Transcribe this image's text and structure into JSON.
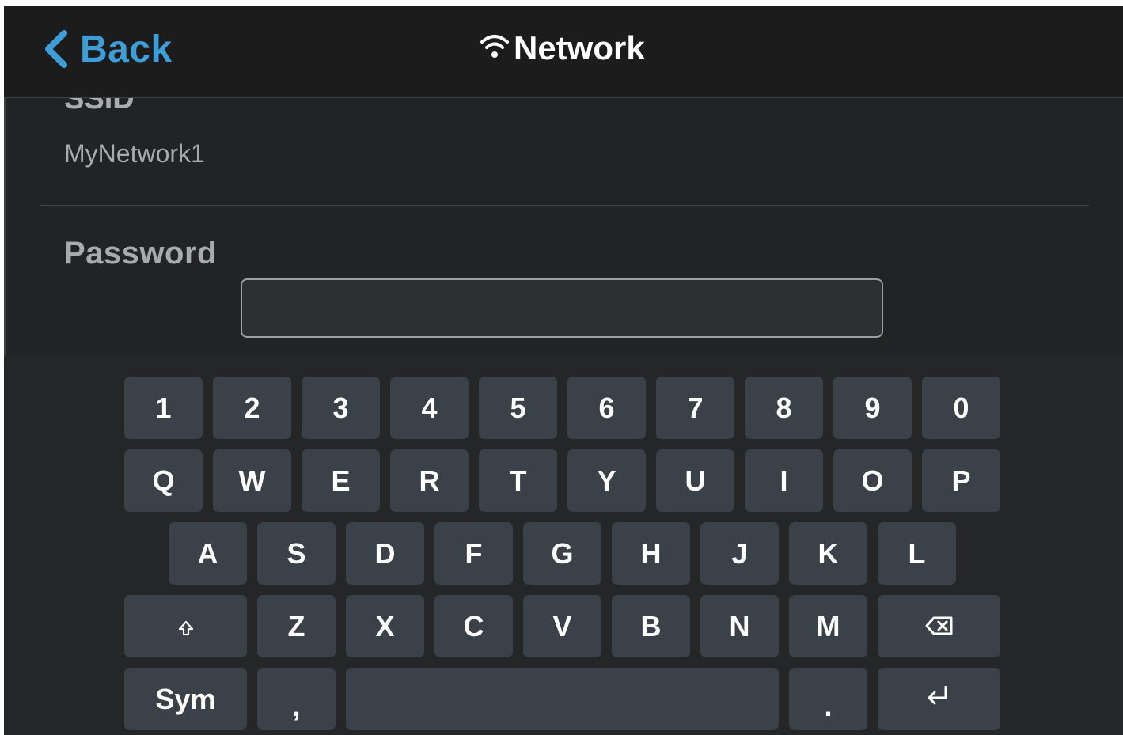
{
  "header": {
    "back_label": "Back",
    "title": "Network",
    "back_icon": "chevron-left-icon",
    "title_icon": "wifi-icon",
    "accent_color": "#3d9ed8"
  },
  "form": {
    "ssid_label": "SSID",
    "ssid_value": "MyNetwork1",
    "password_label": "Password",
    "password_value": ""
  },
  "keyboard": {
    "row1": [
      "1",
      "2",
      "3",
      "4",
      "5",
      "6",
      "7",
      "8",
      "9",
      "0"
    ],
    "row2": [
      "Q",
      "W",
      "E",
      "R",
      "T",
      "Y",
      "U",
      "I",
      "O",
      "P"
    ],
    "row3": [
      "A",
      "S",
      "D",
      "F",
      "G",
      "H",
      "J",
      "K",
      "L"
    ],
    "row4": [
      "Z",
      "X",
      "C",
      "V",
      "B",
      "N",
      "M"
    ],
    "shift_icon": "shift-icon",
    "backspace_icon": "backspace-icon",
    "sym_label": "Sym",
    "comma_label": ",",
    "period_label": ".",
    "enter_icon": "enter-icon",
    "space_label": ""
  }
}
